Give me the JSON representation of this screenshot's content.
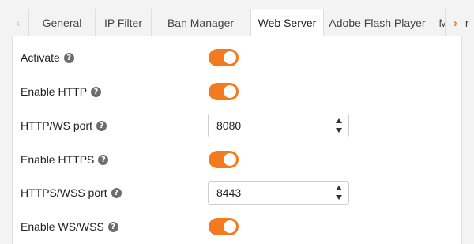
{
  "colors": {
    "accent": "#f47a20",
    "help_icon": "#6d6d6d"
  },
  "tabs": [
    {
      "label": "General",
      "active": false
    },
    {
      "label": "IP Filter",
      "active": false
    },
    {
      "label": "Ban Manager",
      "active": false
    },
    {
      "label": "Web Server",
      "active": true
    },
    {
      "label": "Adobe Flash Player",
      "active": false
    },
    {
      "label": "Mailer",
      "active": false
    }
  ],
  "scroll_left_icon": "‹",
  "scroll_right_icon": "›",
  "settings": {
    "activate": {
      "label": "Activate",
      "enabled": true
    },
    "enable_http": {
      "label": "Enable HTTP",
      "enabled": true
    },
    "http_port": {
      "label": "HTTP/WS port",
      "value": "8080"
    },
    "enable_https": {
      "label": "Enable HTTPS",
      "enabled": true
    },
    "https_port": {
      "label": "HTTPS/WSS port",
      "value": "8443"
    },
    "enable_ws": {
      "label": "Enable WS/WSS",
      "enabled": true
    }
  },
  "help_glyph": "?"
}
